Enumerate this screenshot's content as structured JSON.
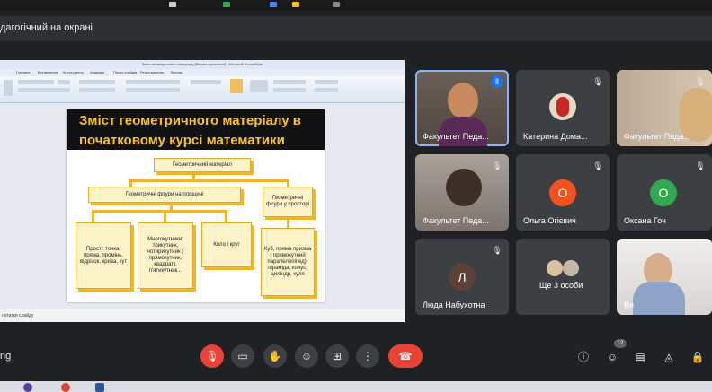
{
  "meeting": {
    "title": "дагогічний на окрані",
    "bottom_left": "ng"
  },
  "presentation": {
    "window_title": "Зміст геометричного матеріалу [Режим сумісності] - Microsoft PowerPoint",
    "ribbon_tabs": [
      "Головна",
      "Вставлення",
      "Конструктор",
      "Анімація",
      "Показ слайдів",
      "Рецензування",
      "Вигляд"
    ],
    "slide": {
      "title_line1": "Зміст геометричного матеріалу в",
      "title_line2": "початковому курсі математики",
      "root": "Геометричний матеріал",
      "plane": "Геометричні фігури на площині",
      "space": "Геометричні фігури у просторі",
      "simple": "Прості: точка, пряма, промінь, відрізок, крива, кут",
      "polygons": "Многокутники: трикутник, чотирикутник ( прямокутник, квадрат), п'ятикутник...",
      "circle": "Коло і круг",
      "solids": "Куб, пряма призма ( прямокутний паралелепіпед), піраміда, конус, циліндр, куля"
    },
    "status": "нотатки слайду"
  },
  "participants": [
    {
      "name": "Факультет Педа...",
      "type": "video",
      "mic": "active"
    },
    {
      "name": "Катерина Дома...",
      "type": "photo",
      "mic": "muted"
    },
    {
      "name": "Факультет Педа...",
      "type": "video",
      "mic": "muted"
    },
    {
      "name": "Факультет Педа...",
      "type": "video",
      "mic": "muted"
    },
    {
      "name": "Ольга Огієвич",
      "type": "avatar",
      "initial": "О",
      "color": "#f4511e",
      "mic": "muted"
    },
    {
      "name": "Оксана Гоч",
      "type": "avatar",
      "initial": "О",
      "color": "#33a852",
      "mic": "muted"
    },
    {
      "name": "Люда Набухотна",
      "type": "avatar",
      "initial": "Л",
      "color": "#5d4037",
      "mic": "muted"
    },
    {
      "name": "Ще 3 особи",
      "type": "group",
      "mic": ""
    },
    {
      "name": "Ви",
      "type": "video",
      "mic": "muted"
    }
  ],
  "controls": {
    "participants_count": "12",
    "items": [
      "mic-off-icon",
      "camera-off-icon",
      "raise-hand-icon",
      "emoji-icon",
      "present-icon",
      "more-icon",
      "end-call-icon"
    ],
    "right_items": [
      "info-icon",
      "people-icon",
      "chat-icon",
      "activities-icon",
      "host-controls-icon"
    ]
  },
  "colors": {
    "background": "#202124",
    "end_call": "#ea4335",
    "accent": "#8ab4f8",
    "slide_title": "#f7c325",
    "slide_box": "#fdf3c8"
  }
}
